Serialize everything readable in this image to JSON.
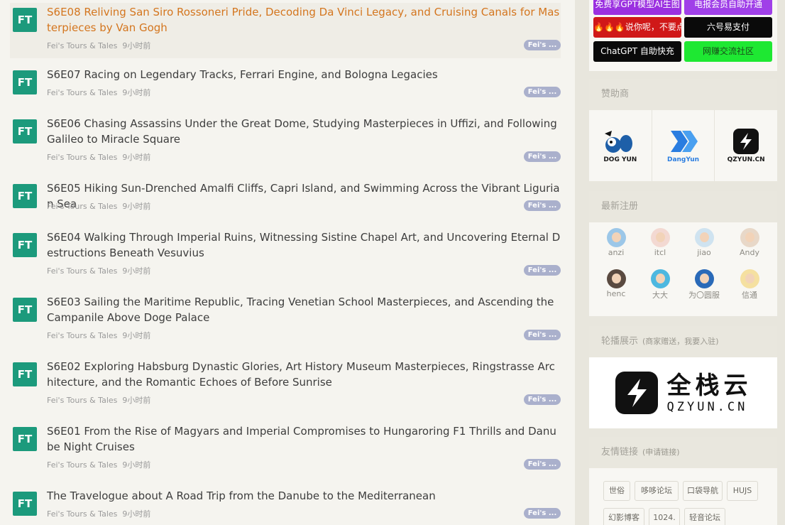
{
  "topics": [
    {
      "avatar": "FT",
      "title": "S6E08 Reliving San Siro Rossoneri Pride, Decoding Da Vinci Legacy, and Cruising Canals for Masterpieces by Van Gogh",
      "author": "Fei's Tours & Tales",
      "time": "9小时前",
      "badge": "Fei's ..."
    },
    {
      "avatar": "FT",
      "title": "S6E07 Racing on Legendary Tracks, Ferrari Engine, and Bologna Legacies",
      "author": "Fei's Tours & Tales",
      "time": "9小时前",
      "badge": "Fei's ..."
    },
    {
      "avatar": "FT",
      "title": "S6E06 Chasing Assassins Under the Great Dome, Studying Masterpieces in Uffizi, and Following Galileo to Miracle Square",
      "author": "Fei's Tours & Tales",
      "time": "9小时前",
      "badge": "Fei's ..."
    },
    {
      "avatar": "FT",
      "title": "S6E05 Hiking Sun-Drenched Amalfi Cliffs, Capri Island, and Swimming Across the Vibrant Ligurian Sea",
      "author": "Fei's Tours & Tales",
      "time": "9小时前",
      "badge": "Fei's ..."
    },
    {
      "avatar": "FT",
      "title": "S6E04 Walking Through Imperial Ruins, Witnessing Sistine Chapel Art, and Uncovering Eternal Destructions Beneath Vesuvius",
      "author": "Fei's Tours & Tales",
      "time": "9小时前",
      "badge": "Fei's ..."
    },
    {
      "avatar": "FT",
      "title": "S6E03 Sailing the Maritime Republic, Tracing Venetian School Masterpieces, and Ascending the Campanile Above Doge Palace",
      "author": "Fei's Tours & Tales",
      "time": "9小时前",
      "badge": "Fei's ..."
    },
    {
      "avatar": "FT",
      "title": "S6E02 Exploring Habsburg Dynastic Glories, Art History Museum Masterpieces, Ringstrasse Architecture, and the Romantic Echoes of Before Sunrise",
      "author": "Fei's Tours & Tales",
      "time": "9小时前",
      "badge": "Fei's ..."
    },
    {
      "avatar": "FT",
      "title": "S6E01 From the Rise of Magyars and Imperial Compromises to Hungaroring F1 Thrills and Danube Night Cruises",
      "author": "Fei's Tours & Tales",
      "time": "9小时前",
      "badge": "Fei's ..."
    },
    {
      "avatar": "FT",
      "title": "The Travelogue about A Road Trip from the Danube to the Mediterranean",
      "author": "Fei's Tours & Tales",
      "time": "9小时前",
      "badge": "Fei's ..."
    }
  ],
  "ads": [
    {
      "label": "免费享GPT模型AI生图",
      "color": "#9b30e0",
      "text_color": "#ffffff"
    },
    {
      "label": "电报会员自助开通",
      "color": "#a040e8",
      "text_color": "#ffffff"
    },
    {
      "label": "🔥🔥🔥说你呢，不要点",
      "color": "#d01818",
      "text_color": "#ffffff"
    },
    {
      "label": "六号易支付",
      "color": "#0a0a0a",
      "text_color": "#ffffff"
    },
    {
      "label": "ChatGPT 自助快充",
      "color": "#0a0a0a",
      "text_color": "#ffffff"
    },
    {
      "label": "网赚交流社区",
      "color": "#1ee832",
      "text_color": "#1a4a1a"
    }
  ],
  "sponsors_panel": {
    "title": "赞助商",
    "items": [
      {
        "name": "DOG YUN",
        "icon": "dog-logo-icon",
        "color": "#1a1a1a"
      },
      {
        "name": "DangYun",
        "icon": "dangyun-logo-icon",
        "color": "#2a7de0"
      },
      {
        "name": "QZYUN.CN",
        "icon": "qzyun-logo-icon",
        "color": "#1a1a1a"
      }
    ]
  },
  "new_users_panel": {
    "title": "最新注册",
    "users": [
      {
        "name": "anzi",
        "color": "#9cc7e8"
      },
      {
        "name": "itcl",
        "color": "#f3d9d2"
      },
      {
        "name": "jiao",
        "color": "#cfe3f0"
      },
      {
        "name": "Andy",
        "color": "#e8d8c8"
      },
      {
        "name": "henc",
        "color": "#5a4a40"
      },
      {
        "name": "大大",
        "color": "#4db8e0"
      },
      {
        "name": "为〇圆服",
        "color": "#2a6ab8"
      },
      {
        "name": "信通",
        "color": "#f5e0a0"
      }
    ]
  },
  "carousel_panel": {
    "title": "轮播展示",
    "subtitle": "(商家赠送，我要入驻)",
    "brand_cn": "全栈云",
    "brand_en": "QZYUN.CN"
  },
  "links_panel": {
    "title": "友情链接",
    "subtitle": "(申请链接)",
    "links": [
      "世俗",
      "哆哆论坛",
      "口袋导航",
      "HUJS",
      "幻影博客",
      "1024.",
      "轻音论坛"
    ]
  }
}
